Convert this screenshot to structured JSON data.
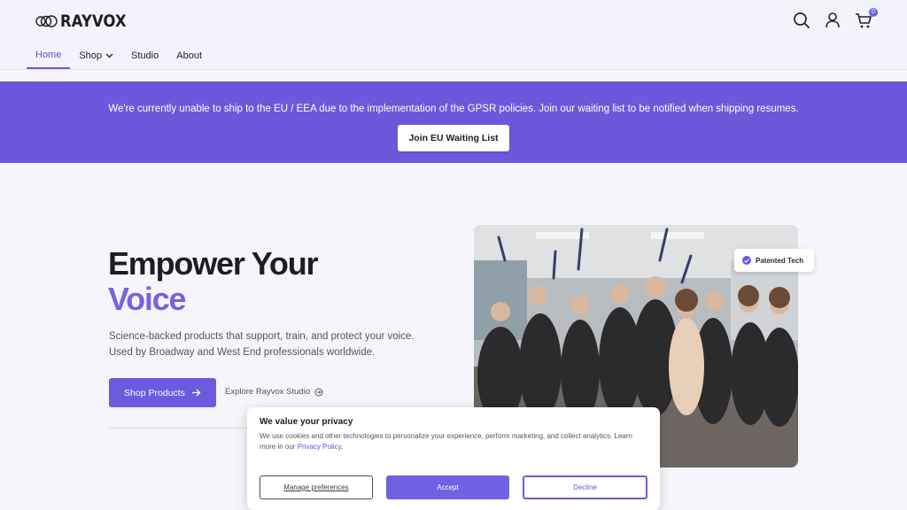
{
  "brand": {
    "name": "RAYVOX",
    "accent": "#6d58dc"
  },
  "header": {
    "icons": [
      "search-icon",
      "user-icon",
      "cart-icon"
    ],
    "cart_count": "0"
  },
  "nav": {
    "home": "Home",
    "shop": "Shop",
    "studio": "Studio",
    "about": "About"
  },
  "banner": {
    "text": "We're currently unable to ship to the EU / EEA due to the implementation of the GPSR policies. Join our waiting list to be notified when shipping resumes.",
    "button": "Join EU Waiting List"
  },
  "hero": {
    "title_line1": "Empower Your",
    "title_line2": "Voice",
    "subtitle": "Science-backed products that support, train, and protect your voice. Used by Broadway and West End professionals worldwide.",
    "primary_button": "Shop Products",
    "secondary_link": "Explore Rayvox Studio"
  },
  "badge": {
    "label": "Patented Tech"
  },
  "cookie": {
    "title": "We value your privacy",
    "text": "We use cookies and other technologies to personalize your experience, perform marketing, and collect analytics. Learn more in our",
    "link": "Privacy Policy",
    "manage": "Manage preferences",
    "accept": "Accept",
    "decline": "Decline"
  }
}
